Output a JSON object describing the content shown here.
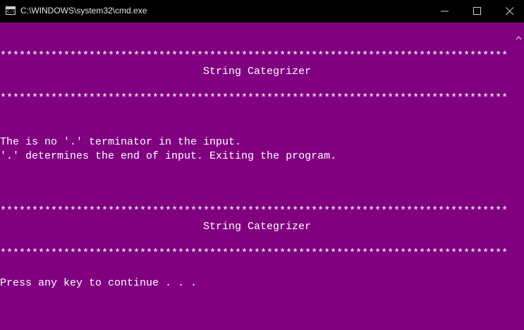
{
  "window": {
    "title": "C:\\WINDOWS\\system32\\cmd.exe",
    "icon_text": "C:\\",
    "console_bg": "#800080",
    "console_fg": "#ffffff",
    "titlebar_bg": "#000000"
  },
  "console": {
    "stars_top1": "********************************************************************************",
    "header1": "String Categrizer",
    "stars_top2": "********************************************************************************",
    "msg1": "The is no '.' terminator in the input.",
    "msg2": "'.' determines the end of input. Exiting the program.",
    "stars_bot1": "********************************************************************************",
    "header2": "String Categrizer",
    "stars_bot2": "********************************************************************************",
    "prompt": "Press any key to continue . . ."
  },
  "controls": {
    "minimize_icon": "minimize-icon",
    "maximize_icon": "maximize-icon",
    "close_icon": "close-icon",
    "scroll_up_icon": "chevron-up-icon"
  }
}
